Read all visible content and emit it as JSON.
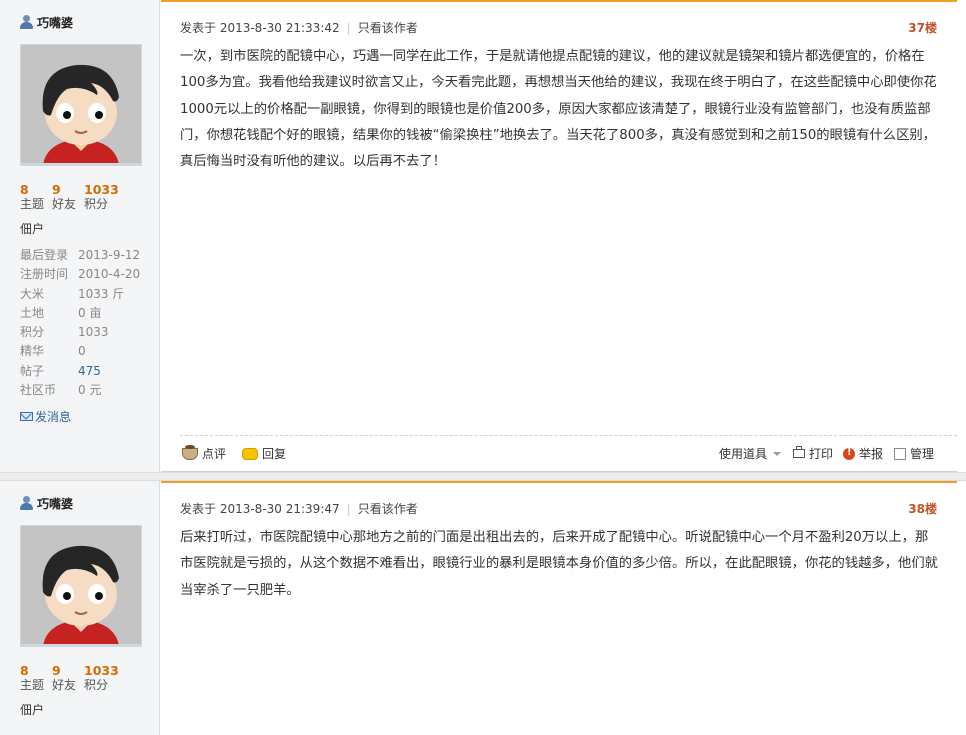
{
  "posts": [
    {
      "author": "巧嘴婆",
      "stats": [
        {
          "value": "8",
          "label": "主题"
        },
        {
          "value": "9",
          "label": "好友"
        },
        {
          "value": "1033",
          "label": "积分"
        }
      ],
      "rank": "佃户",
      "info": [
        {
          "key": "最后登录",
          "value": "2013-9-12"
        },
        {
          "key": "注册时间",
          "value": "2010-4-20"
        },
        {
          "key": "大米",
          "value": "1033 斤"
        },
        {
          "key": "土地",
          "value": "0 亩"
        },
        {
          "key": "积分",
          "value": "1033"
        },
        {
          "key": "精华",
          "value": "0"
        },
        {
          "key": "帖子",
          "value": "475"
        },
        {
          "key": "社区币",
          "value": "0 元"
        }
      ],
      "send_message": "发消息",
      "posted_at": "发表于 2013-8-30 21:33:42",
      "only_author": "只看该作者",
      "floor": "37楼",
      "content": "一次，到市医院的配镜中心，巧遇一同学在此工作，于是就请他提点配镜的建议，他的建议就是镜架和镜片都选便宜的，价格在100多为宜。我看他给我建议时欲言又止，今天看完此题，再想想当天他给的建议，我现在终于明白了，在这些配镜中心即使你花1000元以上的价格配一副眼镜，你得到的眼镜也是价值200多，原因大家都应该清楚了，眼镜行业没有监管部门，也没有质监部门，你想花钱配个好的眼镜，结果你的钱被“偷梁换柱”地换去了。当天花了800多，真没有感觉到和之前150的眼镜有什么区别，真后悔当时没有听他的建议。以后再不去了！",
      "actions": {
        "comment": "点评",
        "reply": "回复",
        "tools": "使用道具",
        "print": "打印",
        "report": "举报",
        "manage": "管理"
      }
    },
    {
      "author": "巧嘴婆",
      "stats": [
        {
          "value": "8",
          "label": "主题"
        },
        {
          "value": "9",
          "label": "好友"
        },
        {
          "value": "1033",
          "label": "积分"
        }
      ],
      "rank": "佃户",
      "posted_at": "发表于 2013-8-30 21:39:47",
      "only_author": "只看该作者",
      "floor": "38楼",
      "content": "后来打听过，市医院配镜中心那地方之前的门面是出租出去的，后来开成了配镜中心。听说配镜中心一个月不盈利20万以上，那市医院就是亏损的，从这个数据不难看出，眼镜行业的暴利是眼镜本身价值的多少倍。所以，在此配眼镜，你花的钱越多，他们就当宰杀了一只肥羊。"
    }
  ],
  "colors": {
    "accent_orange": "#f0a029",
    "floor_red": "#c0542c",
    "stat_orange": "#d66b00",
    "link_blue": "#336699"
  }
}
